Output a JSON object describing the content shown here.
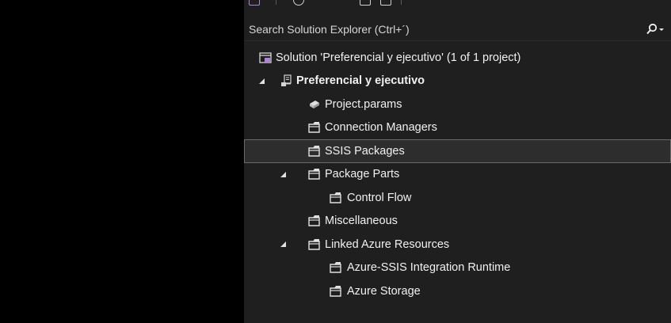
{
  "search": {
    "placeholder": "Search Solution Explorer (Ctrl+´)"
  },
  "tree": {
    "solution": "Solution 'Preferencial y ejecutivo' (1 of 1 project)",
    "project": "Preferencial y ejecutivo",
    "project_params": "Project.params",
    "connection_managers": "Connection Managers",
    "ssis_packages": "SSIS Packages",
    "package_parts": "Package Parts",
    "control_flow": "Control Flow",
    "miscellaneous": "Miscellaneous",
    "linked_azure_resources": "Linked Azure Resources",
    "azure_ssis_ir": "Azure-SSIS Integration Runtime",
    "azure_storage": "Azure Storage"
  },
  "colors": {
    "background": "#1f1f1f",
    "outer_background": "#000000",
    "text": "#f1f1f1",
    "selection": "#2d2d2d",
    "solution_icon": "#b180d7"
  }
}
